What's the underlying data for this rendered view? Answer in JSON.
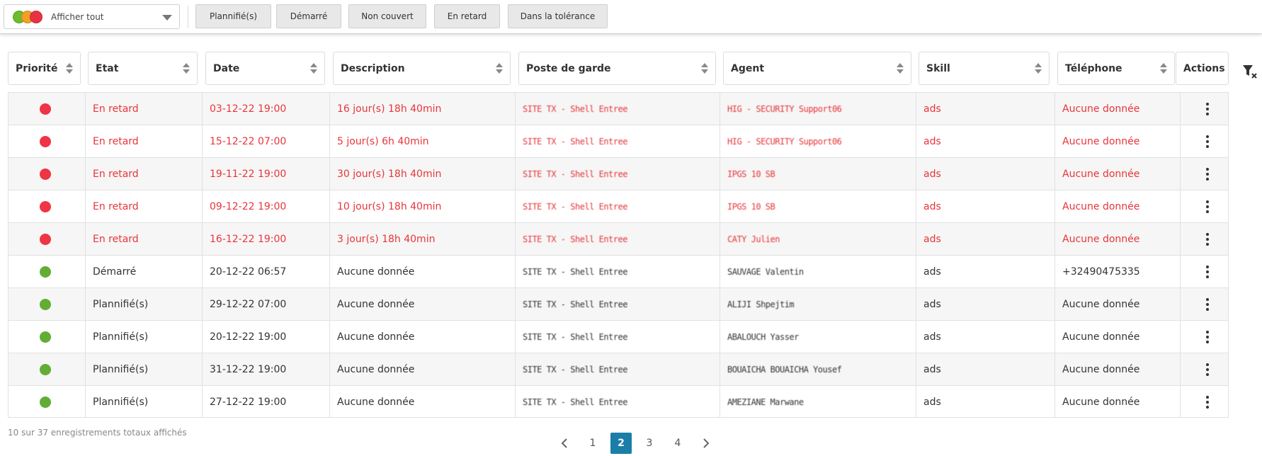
{
  "toolbar": {
    "select_label": "Afficher tout",
    "select_dot_colors": [
      "#6dbb2e",
      "#f29f24",
      "#e83244"
    ],
    "filters": [
      "Plannifié(s)",
      "Démarré",
      "Non couvert",
      "En retard",
      "Dans la tolérance"
    ]
  },
  "columns": [
    "Priorité",
    "Etat",
    "Date",
    "Description",
    "Poste de garde",
    "Agent",
    "Skill",
    "Téléphone",
    "Actions"
  ],
  "colors": {
    "late_text": "#e8353a",
    "late_dot": "#ef3445",
    "ok_dot": "#62ad33",
    "normal_text": "#333333",
    "accent": "#1b7ea8"
  },
  "rows": [
    {
      "status": "late",
      "etat": "En retard",
      "date": "03-12-22 19:00",
      "description": "16 jour(s) 18h 40min",
      "poste": "SITE TX - Shell Entree",
      "agent": "HIG - SECURITY Support06",
      "skill": "ads",
      "telephone": "Aucune donnée"
    },
    {
      "status": "late",
      "etat": "En retard",
      "date": "15-12-22 07:00",
      "description": "5 jour(s) 6h 40min",
      "poste": "SITE TX - Shell Entree",
      "agent": "HIG - SECURITY Support06",
      "skill": "ads",
      "telephone": "Aucune donnée"
    },
    {
      "status": "late",
      "etat": "En retard",
      "date": "19-11-22 19:00",
      "description": "30 jour(s) 18h 40min",
      "poste": "SITE TX - Shell Entree",
      "agent": "IPGS 10 SB",
      "skill": "ads",
      "telephone": "Aucune donnée"
    },
    {
      "status": "late",
      "etat": "En retard",
      "date": "09-12-22 19:00",
      "description": "10 jour(s) 18h 40min",
      "poste": "SITE TX - Shell Entree",
      "agent": "IPGS 10 SB",
      "skill": "ads",
      "telephone": "Aucune donnée"
    },
    {
      "status": "late",
      "etat": "En retard",
      "date": "16-12-22 19:00",
      "description": "3 jour(s) 18h 40min",
      "poste": "SITE TX - Shell Entree",
      "agent": "CATY Julien",
      "skill": "ads",
      "telephone": "Aucune donnée"
    },
    {
      "status": "ok",
      "etat": "Démarré",
      "date": "20-12-22 06:57",
      "description": "Aucune donnée",
      "poste": "SITE TX - Shell Entree",
      "agent": "SAUVAGE Valentin",
      "skill": "ads",
      "telephone": "+32490475335"
    },
    {
      "status": "ok",
      "etat": "Plannifié(s)",
      "date": "29-12-22 07:00",
      "description": "Aucune donnée",
      "poste": "SITE TX - Shell Entree",
      "agent": "ALIJI Shpejtim",
      "skill": "ads",
      "telephone": "Aucune donnée"
    },
    {
      "status": "ok",
      "etat": "Plannifié(s)",
      "date": "20-12-22 19:00",
      "description": "Aucune donnée",
      "poste": "SITE TX - Shell Entree",
      "agent": "ABALOUCH Yasser",
      "skill": "ads",
      "telephone": "Aucune donnée"
    },
    {
      "status": "ok",
      "etat": "Plannifié(s)",
      "date": "31-12-22 19:00",
      "description": "Aucune donnée",
      "poste": "SITE TX - Shell Entree",
      "agent": "BOUAICHA BOUAICHA Yousef",
      "skill": "ads",
      "telephone": "Aucune donnée"
    },
    {
      "status": "ok",
      "etat": "Plannifié(s)",
      "date": "27-12-22 19:00",
      "description": "Aucune donnée",
      "poste": "SITE TX - Shell Entree",
      "agent": "AMEZIANE Marwane",
      "skill": "ads",
      "telephone": "Aucune donnée"
    }
  ],
  "footer": {
    "count_text": "10  sur  37  enregistrements totaux affichés",
    "pages": [
      "1",
      "2",
      "3",
      "4"
    ],
    "current_page": "2",
    "prev_icon": "chevron-left-icon",
    "next_icon": "chevron-right-icon"
  },
  "icons": {
    "filter_clear": "filter-clear-icon",
    "row_actions": "kebab-menu-icon",
    "sort": "sort-icon"
  }
}
